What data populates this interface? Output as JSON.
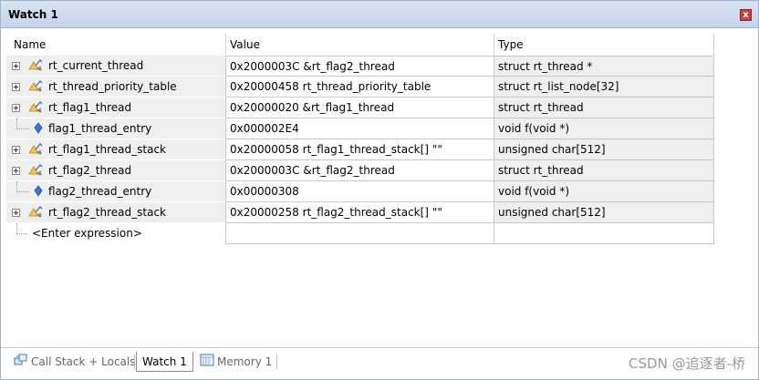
{
  "window": {
    "title": "Watch 1",
    "close_label": "x"
  },
  "columns": {
    "name": "Name",
    "value": "Value",
    "type": "Type"
  },
  "rows": [
    {
      "name": "rt_current_thread",
      "value": "0x2000003C &rt_flag2_thread",
      "type": "struct rt_thread *",
      "kind": "struct"
    },
    {
      "name": "rt_thread_priority_table",
      "value": "0x20000458 rt_thread_priority_table",
      "type": "struct rt_list_node[32]",
      "kind": "struct"
    },
    {
      "name": "rt_flag1_thread",
      "value": "0x20000020 &rt_flag1_thread",
      "type": "struct rt_thread",
      "kind": "struct"
    },
    {
      "name": "flag1_thread_entry",
      "value": "0x000002E4",
      "type": "void f(void *)",
      "kind": "function"
    },
    {
      "name": "rt_flag1_thread_stack",
      "value": "0x20000058 rt_flag1_thread_stack[] \"\"",
      "type": "unsigned char[512]",
      "kind": "struct"
    },
    {
      "name": "rt_flag2_thread",
      "value": "0x2000003C &rt_flag2_thread",
      "type": "struct rt_thread",
      "kind": "struct"
    },
    {
      "name": "flag2_thread_entry",
      "value": "0x00000308",
      "type": "void f(void *)",
      "kind": "function"
    },
    {
      "name": "rt_flag2_thread_stack",
      "value": "0x20000258 rt_flag2_thread_stack[] \"\"",
      "type": "unsigned char[512]",
      "kind": "struct"
    }
  ],
  "enter_expression": "<Enter expression>",
  "tabs": [
    {
      "label": "Call Stack + Locals",
      "icon": "call-stack-icon",
      "active": false
    },
    {
      "label": "Watch 1",
      "icon": "",
      "active": true
    },
    {
      "label": "Memory 1",
      "icon": "memory-icon",
      "active": false
    }
  ],
  "watermark": "CSDN @追逐者-桥"
}
